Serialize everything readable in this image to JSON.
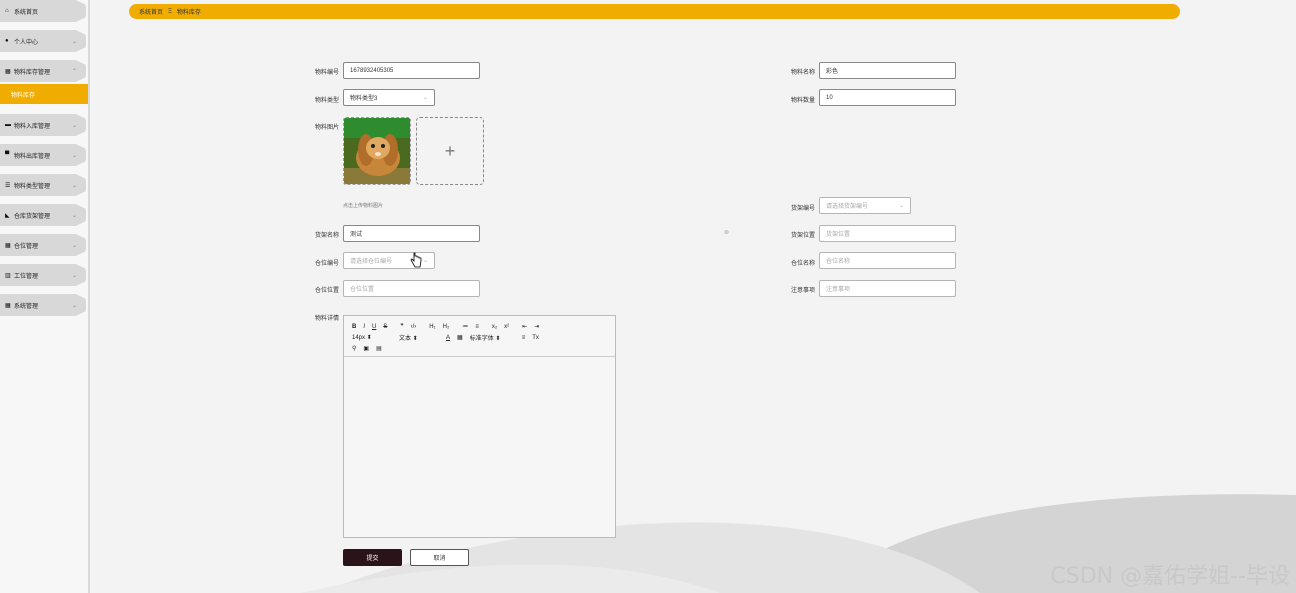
{
  "sidebar": {
    "items": [
      {
        "label": "系统首页",
        "icon": "home-icon",
        "glyph": "⌂"
      },
      {
        "label": "个人中心",
        "icon": "user-icon",
        "glyph": "●"
      },
      {
        "label": "物料库存管理",
        "icon": "grid-icon",
        "glyph": "▦"
      },
      {
        "label": "物料入库管理",
        "icon": "card-icon",
        "glyph": "▬"
      },
      {
        "label": "物料出库管理",
        "icon": "monitor-icon",
        "glyph": "▀"
      },
      {
        "label": "物料类型管理",
        "icon": "list-icon",
        "glyph": "☰"
      },
      {
        "label": "仓库货架管理",
        "icon": "shelf-icon",
        "glyph": "◣"
      },
      {
        "label": "仓位管理",
        "icon": "grid-icon",
        "glyph": "▦"
      },
      {
        "label": "工位管理",
        "icon": "chart-icon",
        "glyph": "▥"
      },
      {
        "label": "系统管理",
        "icon": "grid-icon",
        "glyph": "▦"
      }
    ],
    "active_sub": "物料库存"
  },
  "breadcrumb": {
    "home": "系统首页",
    "sep": "Ξ",
    "current": "物料库存"
  },
  "form": {
    "material_no_label": "物料编号",
    "material_no": "1678932405305",
    "material_name_label": "物料名称",
    "material_name": "彩色",
    "material_type_label": "物料类型",
    "material_type": "物料类型3",
    "material_qty_label": "物料数量",
    "material_qty": "10",
    "material_image_label": "物料图片",
    "upload_tip": "点击上传物料图片",
    "shelf_no_label": "货架编号",
    "shelf_no_placeholder": "请选择货架编号",
    "shelf_name_label": "货架名称",
    "shelf_name": "测试",
    "shelf_pos_label": "货架位置",
    "shelf_pos_placeholder": "货架位置",
    "slot_no_label": "仓位编号",
    "slot_no_placeholder": "请选择仓位编号",
    "slot_name_label": "仓位名称",
    "slot_name_placeholder": "仓位名称",
    "slot_pos_label": "仓位位置",
    "slot_pos_placeholder": "仓位位置",
    "notes_label": "注意事项",
    "notes_placeholder": "注意事项",
    "detail_label": "物料详情"
  },
  "editor": {
    "row1": [
      "B",
      "I",
      "U",
      "S",
      "❞",
      "‹/›",
      "H₁",
      "H₂",
      "≔",
      "≡",
      "x₂",
      "x²",
      "⇤",
      "⇥"
    ],
    "font_size": "14px",
    "block": "文本",
    "font_family": "标准字体",
    "row3": [
      "🔗",
      "▣",
      "▤"
    ]
  },
  "buttons": {
    "submit": "提交",
    "cancel": "取消"
  },
  "watermark": "CSDN @嘉佑学姐--毕设",
  "colors": {
    "accent": "#f0ad00",
    "primary_button": "#2b1419"
  }
}
